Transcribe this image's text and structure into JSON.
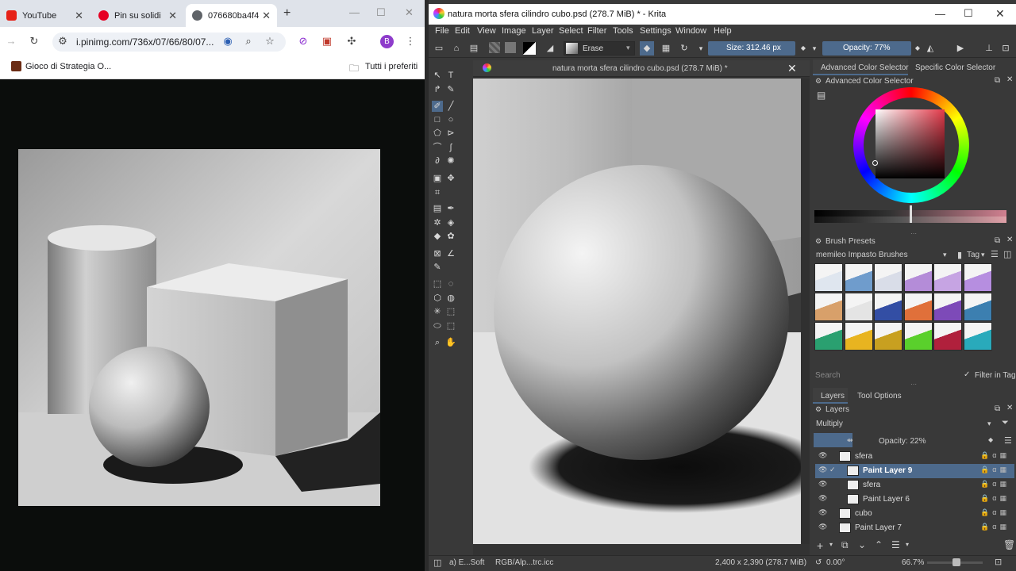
{
  "browser": {
    "tabs": [
      {
        "label": "YouTube",
        "fav_color": "#e62117"
      },
      {
        "label": "Pin su solidi",
        "fav_color": "#e60023"
      },
      {
        "label": "076680ba4f4",
        "fav_color": "#5f6368"
      }
    ],
    "new_tab": "+",
    "url": "i.pinimg.com/736x/07/66/80/07...",
    "profile_initial": "B",
    "bookmarks": [
      {
        "label": "Gioco di Strategia O..."
      },
      {
        "label": "Tutti i preferiti"
      }
    ]
  },
  "krita": {
    "window_title": "natura morta sfera cilindro cubo.psd (278.7 MiB) * - Krita",
    "menus": [
      "File",
      "Edit",
      "View",
      "Image",
      "Layer",
      "Select",
      "Filter",
      "Tools",
      "Settings",
      "Window",
      "Help"
    ],
    "toolbar": {
      "blend_mode": "Erase",
      "size_label": "Size: 312.46 px",
      "opacity_label": "Opacity: 77%"
    },
    "document_tab": "natura morta sfera cilindro cubo.psd (278.7 MiB) *",
    "dock_tabs": {
      "advanced": "Advanced Color Selector",
      "specific": "Specific Color Selector"
    },
    "advanced_color_selector_title": "Advanced Color Selector",
    "brush_presets": {
      "title": "Brush Presets",
      "group": "memileo Impasto Brushes",
      "tag_label": "Tag",
      "search_placeholder": "Search",
      "filter_label": "Filter in Tag",
      "swatches": [
        "#dfe6ef",
        "#6f9ccc",
        "#d9dde8",
        "#b48cd8",
        "#c6a4e3",
        "#b68ee0",
        "#d8a06a",
        "#e4e4e4",
        "#334ea4",
        "#e0703a",
        "#7d4ab8",
        "#3c7fb0",
        "#2aa070",
        "#e8b420",
        "#c8a020",
        "#5ad02c",
        "#b0203c",
        "#29aabb"
      ]
    },
    "layers_panel": {
      "tabs": [
        "Layers",
        "Tool Options"
      ],
      "title": "Layers",
      "blend_mode": "Multiply",
      "opacity_label": "Opacity:  22%",
      "layers": [
        {
          "name": "sfera",
          "selected": false
        },
        {
          "name": "Paint Layer 9",
          "selected": true
        },
        {
          "name": "sfera",
          "selected": false
        },
        {
          "name": "Paint Layer 6",
          "selected": false
        },
        {
          "name": "cubo",
          "selected": false
        },
        {
          "name": "Paint Layer 7",
          "selected": false
        }
      ]
    },
    "status": {
      "brush": "a) E...Soft",
      "color_space": "RGB/Alp...trc.icc",
      "dimensions": "2,400 x 2,390 (278.7 MiB)",
      "rotation": "0.00°",
      "zoom": "66.7%"
    }
  }
}
